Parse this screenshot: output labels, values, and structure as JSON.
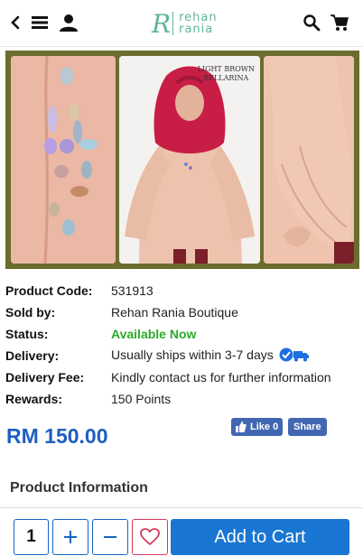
{
  "header": {
    "logo_mark": "R",
    "logo_line1": "rehan",
    "logo_line2": "rania"
  },
  "hero": {
    "caption_line1": "LIGHT BROWN",
    "caption_line2": "BELLARINA"
  },
  "details": [
    {
      "label": "Product Code:",
      "value": "531913"
    },
    {
      "label": "Sold by:",
      "value": "Rehan Rania Boutique"
    },
    {
      "label": "Status:",
      "value": "Available Now"
    },
    {
      "label": "Delivery:",
      "value": "Usually ships within 3-7 days"
    },
    {
      "label": "Delivery Fee:",
      "value": "Kindly contact us for further information"
    },
    {
      "label": "Rewards:",
      "value": "150 Points"
    }
  ],
  "price": "RM 150.00",
  "facebook": {
    "like_label": "Like 0",
    "share_label": "Share"
  },
  "section_title": "Product Information",
  "cart": {
    "quantity": "1",
    "add_label": "Add to Cart"
  },
  "colors": {
    "brand": "#5fb39a",
    "price": "#1f5fbf",
    "status": "#2aaa2a",
    "cart_button": "#1976d2",
    "favorite": "#d23a5a"
  }
}
